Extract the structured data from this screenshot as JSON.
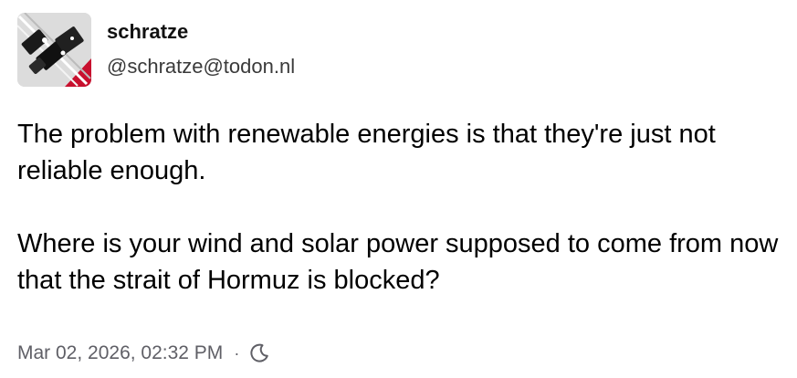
{
  "post": {
    "author": {
      "display_name": "schratze",
      "handle": "@schratze@todon.nl",
      "avatar_icon": "avatar-image"
    },
    "content": {
      "paragraphs": [
        "The problem with renewable energies is that they're just not reliable enough.",
        "Where is your wind and solar power supposed to come from now that the strait of Hormuz is blocked?"
      ]
    },
    "meta": {
      "timestamp": "Mar 02, 2026, 02:32 PM",
      "separator": "·",
      "visibility_icon": "moon-icon"
    }
  },
  "colors": {
    "text": "#000000",
    "muted": "#5f5f66",
    "avatar_red": "#c8102e"
  }
}
